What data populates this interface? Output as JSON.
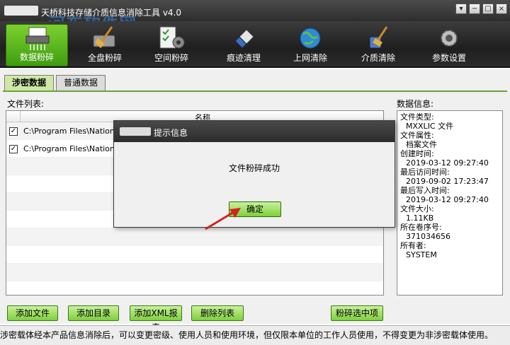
{
  "window": {
    "title": "天桥科技存储介质信息消除工具 v4.0",
    "watermark_text": "河东软件网",
    "watermark_url": "www.pc0359.cn",
    "controls": {
      "menu": "▾",
      "minimize": "−",
      "maximize": "□",
      "close": "×"
    }
  },
  "toolbar": {
    "items": [
      {
        "label": "数据粉碎",
        "icon": "shredder-icon",
        "active": true
      },
      {
        "label": "全盘粉碎",
        "icon": "disk-broom-icon",
        "active": false
      },
      {
        "label": "空间粉碎",
        "icon": "checklist-gear-icon",
        "active": false
      },
      {
        "label": "痕迹清理",
        "icon": "eraser-icon",
        "active": false
      },
      {
        "label": "上网清除",
        "icon": "globe-icon",
        "active": false
      },
      {
        "label": "介质清除",
        "icon": "usb-broom-icon",
        "active": false
      },
      {
        "label": "参数设置",
        "icon": "gear-icon",
        "active": false
      }
    ]
  },
  "tabs": [
    {
      "label": "涉密数据",
      "selected": true
    },
    {
      "label": "普通数据",
      "selected": false
    }
  ],
  "file_list": {
    "label": "文件列表:",
    "column_name": "名称",
    "rows": [
      {
        "checked": true,
        "path": "C:\\Program Files\\National I"
      },
      {
        "checked": true,
        "path": "C:\\Program Files\\National I"
      }
    ],
    "empty_rows": 8
  },
  "data_info": {
    "label": "数据信息:",
    "fields": [
      {
        "key": "文件类型:",
        "value": "MXXLIC 文件"
      },
      {
        "key": "文件属性:",
        "value": "档案文件"
      },
      {
        "key": "创建时间:",
        "value": "2019-03-12 09:27:40"
      },
      {
        "key": "最后访问时间:",
        "value": "2019-09-02 17:23:47"
      },
      {
        "key": "最后写入时间:",
        "value": "2019-03-12 09:27:40"
      },
      {
        "key": "文件大小:",
        "value": "1.11KB"
      },
      {
        "key": "所在卷序号:",
        "value": "371034656"
      },
      {
        "key": "所有者:",
        "value": "SYSTEM"
      }
    ]
  },
  "buttons": {
    "add_file": "添加文件",
    "add_folder": "添加目录",
    "add_xml": "添加XML报表",
    "delete_list": "删除列表",
    "shred_selected": "粉碎选中项"
  },
  "status_text": "涉密载体经本产品信息消除后，可以变更密级、使用人员和使用环境，但仅限本单位的工作人员使用，不得变更为非涉密载体使用。",
  "dialog": {
    "title": "提示信息",
    "message": "文件粉碎成功",
    "ok_label": "确定"
  },
  "colors": {
    "accent_green": "#7fcf3c",
    "title_bar": "#2e2e2e",
    "pointer_arrow": "#d42020"
  }
}
